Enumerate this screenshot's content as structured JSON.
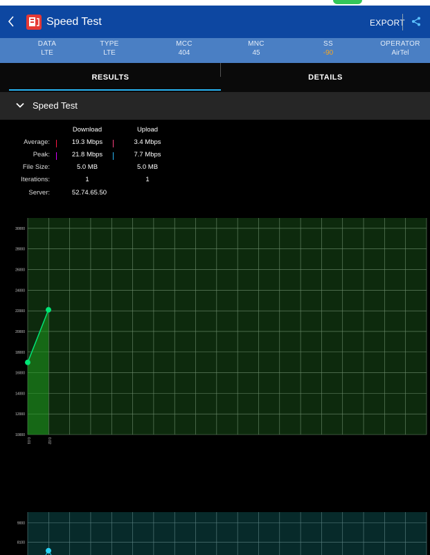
{
  "app": {
    "title": "Speed Test",
    "export_label": "EXPORT",
    "icons": {
      "back": "chevron-left-icon",
      "app": "speed-test-app-icon",
      "share": "share-icon"
    },
    "colors": {
      "navbar": "#0d47a1",
      "infobar": "#4a7fc4",
      "accent": "#29b6f6",
      "download": "#00e676",
      "upload": "#29d3f6"
    }
  },
  "info": {
    "columns": [
      {
        "label": "DATA",
        "value": "LTE"
      },
      {
        "label": "TYPE",
        "value": "LTE"
      },
      {
        "label": "MCC",
        "value": "404"
      },
      {
        "label": "MNC",
        "value": "45"
      },
      {
        "label": "SS",
        "value": "-90"
      },
      {
        "label": "OPERATOR",
        "value": "AirTel"
      }
    ]
  },
  "tabs": [
    {
      "label": "RESULTS",
      "selected": true
    },
    {
      "label": "DETAILS",
      "selected": false
    }
  ],
  "section": {
    "title": "Speed Test",
    "icon": "chevron-down-icon",
    "expanded": true
  },
  "stats": {
    "headers": {
      "download": "Download",
      "upload": "Upload"
    },
    "rows": [
      {
        "label": "Average:",
        "download": "19.3 Mbps",
        "upload": "3.4 Mbps"
      },
      {
        "label": "Peak:",
        "download": "21.8 Mbps",
        "upload": "7.7 Mbps"
      },
      {
        "label": "File Size:",
        "download": "5.0 MB",
        "upload": "5.0 MB"
      },
      {
        "label": "Iterations:",
        "download": "1",
        "upload": "1"
      }
    ],
    "server": {
      "label": "Server:",
      "value": "52.74.65.50"
    }
  },
  "chart_data": [
    {
      "type": "area",
      "title": "",
      "xlabel": "",
      "ylabel": "",
      "y_ticks": [
        10000,
        12000,
        14000,
        16000,
        18000,
        20000,
        22000,
        24000,
        26000,
        28000,
        30000
      ],
      "ylim": [
        10000,
        31000
      ],
      "x_ticks": [
        "0.01",
        "0.02"
      ],
      "grid": true,
      "series": [
        {
          "x": [
            0.01,
            0.02
          ],
          "y": [
            17000,
            22100
          ]
        }
      ]
    },
    {
      "type": "area",
      "title": "",
      "xlabel": "",
      "ylabel": "",
      "y_ticks": [
        8100,
        9000
      ],
      "ylim": [
        7500,
        9500
      ],
      "grid": true,
      "series": [
        {
          "x": [
            0.02
          ],
          "y": [
            7700
          ]
        }
      ]
    }
  ]
}
